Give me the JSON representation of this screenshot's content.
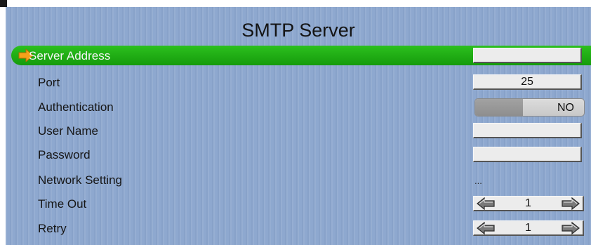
{
  "title": "SMTP Server",
  "rows": [
    {
      "label": "Server Address",
      "value": "",
      "type": "text",
      "selected": true
    },
    {
      "label": "Port",
      "value": "25",
      "type": "text"
    },
    {
      "label": "Authentication",
      "value": "NO",
      "type": "toggle"
    },
    {
      "label": "User Name",
      "value": "",
      "type": "text"
    },
    {
      "label": "Password",
      "value": "",
      "type": "text"
    },
    {
      "label": "Network Setting",
      "value": "...",
      "type": "submenu"
    },
    {
      "label": "Time Out",
      "value": "1",
      "type": "spinner"
    },
    {
      "label": "Retry",
      "value": "1",
      "type": "spinner"
    }
  ],
  "colors": {
    "panel_background": "#8ea8cf",
    "selection": "#1fae14",
    "selection_arrow": "#f5a21a",
    "field_background": "#ececec"
  },
  "icons": {
    "selection": "arrow-right-icon",
    "decrement": "arrow-left-icon",
    "increment": "arrow-right-icon"
  }
}
